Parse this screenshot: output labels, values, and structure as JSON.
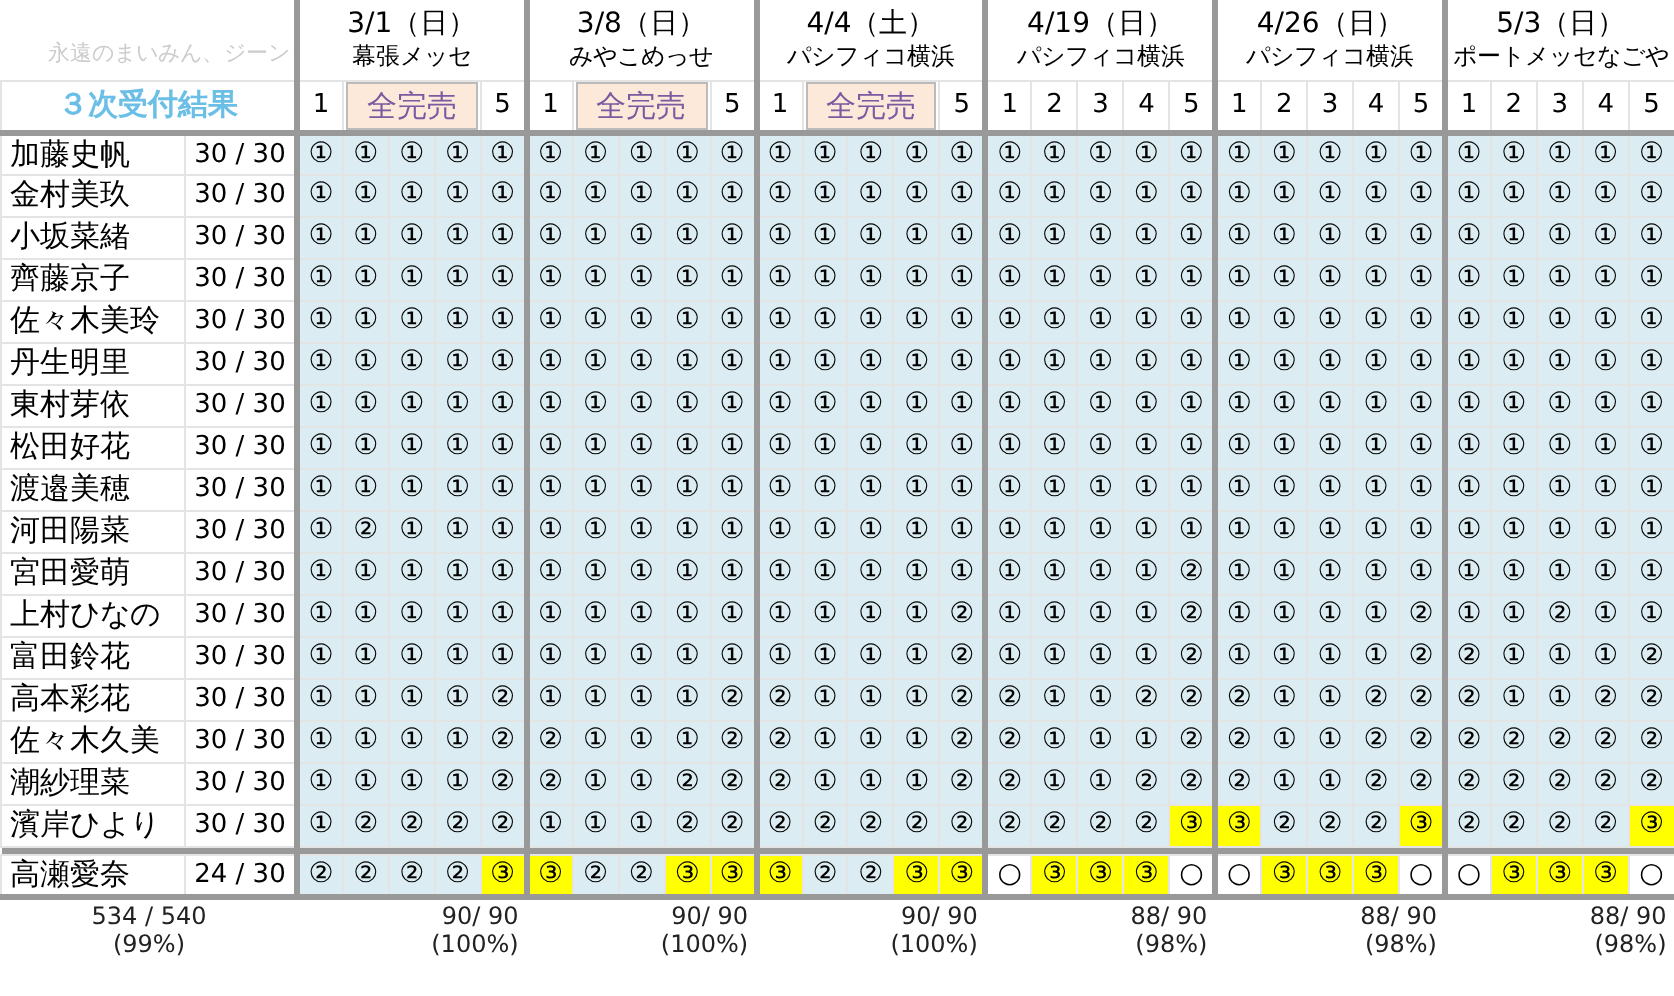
{
  "caption": "永遠のまいみん、ジーン",
  "title": "３次受付結果",
  "shows": [
    {
      "date": "3/1（日）",
      "venue": "幕張メッセ",
      "slot_labels": [
        "1",
        "5"
      ],
      "badge": "全完売",
      "total": "90/ 90",
      "percent": "(100%)"
    },
    {
      "date": "3/8（日）",
      "venue": "みやこめっせ",
      "slot_labels": [
        "1",
        "5"
      ],
      "badge": "全完売",
      "total": "90/ 90",
      "percent": "(100%)"
    },
    {
      "date": "4/4（土）",
      "venue": "パシフィコ横浜",
      "slot_labels": [
        "1",
        "5"
      ],
      "badge": "全完売",
      "total": "90/ 90",
      "percent": "(100%)"
    },
    {
      "date": "4/19（日）",
      "venue": "パシフィコ横浜",
      "slot_labels": [
        "1",
        "2",
        "3",
        "4",
        "5"
      ],
      "total": "88/ 90",
      "percent": "(98%)"
    },
    {
      "date": "4/26（日）",
      "venue": "パシフィコ横浜",
      "slot_labels": [
        "1",
        "2",
        "3",
        "4",
        "5"
      ],
      "total": "88/ 90",
      "percent": "(98%)"
    },
    {
      "date": "5/3（日）",
      "venue": "ポートメッセなごや",
      "slot_labels": [
        "1",
        "2",
        "3",
        "4",
        "5"
      ],
      "total": "88/ 90",
      "percent": "(98%)"
    }
  ],
  "members": [
    {
      "name": "加藤史帆",
      "count": "30 / 30",
      "cells": [
        "①",
        "①",
        "①",
        "①",
        "①",
        "①",
        "①",
        "①",
        "①",
        "①",
        "①",
        "①",
        "①",
        "①",
        "①",
        "①",
        "①",
        "①",
        "①",
        "①",
        "①",
        "①",
        "①",
        "①",
        "①",
        "①",
        "①",
        "①",
        "①",
        "①"
      ]
    },
    {
      "name": "金村美玖",
      "count": "30 / 30",
      "cells": [
        "①",
        "①",
        "①",
        "①",
        "①",
        "①",
        "①",
        "①",
        "①",
        "①",
        "①",
        "①",
        "①",
        "①",
        "①",
        "①",
        "①",
        "①",
        "①",
        "①",
        "①",
        "①",
        "①",
        "①",
        "①",
        "①",
        "①",
        "①",
        "①",
        "①"
      ]
    },
    {
      "name": "小坂菜緒",
      "count": "30 / 30",
      "cells": [
        "①",
        "①",
        "①",
        "①",
        "①",
        "①",
        "①",
        "①",
        "①",
        "①",
        "①",
        "①",
        "①",
        "①",
        "①",
        "①",
        "①",
        "①",
        "①",
        "①",
        "①",
        "①",
        "①",
        "①",
        "①",
        "①",
        "①",
        "①",
        "①",
        "①"
      ]
    },
    {
      "name": "齊藤京子",
      "count": "30 / 30",
      "cells": [
        "①",
        "①",
        "①",
        "①",
        "①",
        "①",
        "①",
        "①",
        "①",
        "①",
        "①",
        "①",
        "①",
        "①",
        "①",
        "①",
        "①",
        "①",
        "①",
        "①",
        "①",
        "①",
        "①",
        "①",
        "①",
        "①",
        "①",
        "①",
        "①",
        "①"
      ]
    },
    {
      "name": "佐々木美玲",
      "count": "30 / 30",
      "cells": [
        "①",
        "①",
        "①",
        "①",
        "①",
        "①",
        "①",
        "①",
        "①",
        "①",
        "①",
        "①",
        "①",
        "①",
        "①",
        "①",
        "①",
        "①",
        "①",
        "①",
        "①",
        "①",
        "①",
        "①",
        "①",
        "①",
        "①",
        "①",
        "①",
        "①"
      ]
    },
    {
      "name": "丹生明里",
      "count": "30 / 30",
      "cells": [
        "①",
        "①",
        "①",
        "①",
        "①",
        "①",
        "①",
        "①",
        "①",
        "①",
        "①",
        "①",
        "①",
        "①",
        "①",
        "①",
        "①",
        "①",
        "①",
        "①",
        "①",
        "①",
        "①",
        "①",
        "①",
        "①",
        "①",
        "①",
        "①",
        "①"
      ]
    },
    {
      "name": "東村芽依",
      "count": "30 / 30",
      "cells": [
        "①",
        "①",
        "①",
        "①",
        "①",
        "①",
        "①",
        "①",
        "①",
        "①",
        "①",
        "①",
        "①",
        "①",
        "①",
        "①",
        "①",
        "①",
        "①",
        "①",
        "①",
        "①",
        "①",
        "①",
        "①",
        "①",
        "①",
        "①",
        "①",
        "①"
      ]
    },
    {
      "name": "松田好花",
      "count": "30 / 30",
      "cells": [
        "①",
        "①",
        "①",
        "①",
        "①",
        "①",
        "①",
        "①",
        "①",
        "①",
        "①",
        "①",
        "①",
        "①",
        "①",
        "①",
        "①",
        "①",
        "①",
        "①",
        "①",
        "①",
        "①",
        "①",
        "①",
        "①",
        "①",
        "①",
        "①",
        "①"
      ]
    },
    {
      "name": "渡邉美穂",
      "count": "30 / 30",
      "cells": [
        "①",
        "①",
        "①",
        "①",
        "①",
        "①",
        "①",
        "①",
        "①",
        "①",
        "①",
        "①",
        "①",
        "①",
        "①",
        "①",
        "①",
        "①",
        "①",
        "①",
        "①",
        "①",
        "①",
        "①",
        "①",
        "①",
        "①",
        "①",
        "①",
        "①"
      ]
    },
    {
      "name": "河田陽菜",
      "count": "30 / 30",
      "cells": [
        "①",
        "②",
        "①",
        "①",
        "①",
        "①",
        "①",
        "①",
        "①",
        "①",
        "①",
        "①",
        "①",
        "①",
        "①",
        "①",
        "①",
        "①",
        "①",
        "①",
        "①",
        "①",
        "①",
        "①",
        "①",
        "①",
        "①",
        "①",
        "①",
        "①"
      ]
    },
    {
      "name": "宮田愛萌",
      "count": "30 / 30",
      "cells": [
        "①",
        "①",
        "①",
        "①",
        "①",
        "①",
        "①",
        "①",
        "①",
        "①",
        "①",
        "①",
        "①",
        "①",
        "①",
        "①",
        "①",
        "①",
        "①",
        "②",
        "①",
        "①",
        "①",
        "①",
        "①",
        "①",
        "①",
        "①",
        "①",
        "①"
      ]
    },
    {
      "name": "上村ひなの",
      "count": "30 / 30",
      "cells": [
        "①",
        "①",
        "①",
        "①",
        "①",
        "①",
        "①",
        "①",
        "①",
        "①",
        "①",
        "①",
        "①",
        "①",
        "②",
        "①",
        "①",
        "①",
        "①",
        "②",
        "①",
        "①",
        "①",
        "①",
        "②",
        "①",
        "①",
        "②",
        "①",
        "①"
      ]
    },
    {
      "name": "富田鈴花",
      "count": "30 / 30",
      "cells": [
        "①",
        "①",
        "①",
        "①",
        "①",
        "①",
        "①",
        "①",
        "①",
        "①",
        "①",
        "①",
        "①",
        "①",
        "②",
        "①",
        "①",
        "①",
        "①",
        "②",
        "①",
        "①",
        "①",
        "①",
        "②",
        "②",
        "①",
        "①",
        "①",
        "②"
      ]
    },
    {
      "name": "高本彩花",
      "count": "30 / 30",
      "cells": [
        "①",
        "①",
        "①",
        "①",
        "②",
        "①",
        "①",
        "①",
        "①",
        "②",
        "②",
        "①",
        "①",
        "①",
        "②",
        "②",
        "①",
        "①",
        "②",
        "②",
        "②",
        "①",
        "①",
        "②",
        "②",
        "②",
        "①",
        "①",
        "②",
        "②"
      ]
    },
    {
      "name": "佐々木久美",
      "count": "30 / 30",
      "cells": [
        "①",
        "①",
        "①",
        "①",
        "②",
        "②",
        "①",
        "①",
        "①",
        "②",
        "②",
        "①",
        "①",
        "①",
        "②",
        "②",
        "①",
        "①",
        "①",
        "②",
        "②",
        "①",
        "①",
        "②",
        "②",
        "②",
        "②",
        "②",
        "②",
        "②"
      ]
    },
    {
      "name": "潮紗理菜",
      "count": "30 / 30",
      "cells": [
        "①",
        "①",
        "①",
        "①",
        "②",
        "②",
        "①",
        "①",
        "②",
        "②",
        "②",
        "①",
        "①",
        "①",
        "②",
        "②",
        "①",
        "①",
        "②",
        "②",
        "②",
        "①",
        "①",
        "②",
        "②",
        "②",
        "②",
        "②",
        "②",
        "②"
      ]
    },
    {
      "name": "濱岸ひより",
      "count": "30 / 30",
      "cells": [
        "①",
        "②",
        "②",
        "②",
        "②",
        "①",
        "①",
        "①",
        "②",
        "②",
        "②",
        "②",
        "②",
        "②",
        "②",
        "②",
        "②",
        "②",
        "②",
        {
          "text": "③",
          "highlight": true
        },
        {
          "text": "③",
          "highlight": true
        },
        "②",
        "②",
        "②",
        {
          "text": "③",
          "highlight": true
        },
        "②",
        "②",
        "②",
        "②",
        {
          "text": "③",
          "highlight": true
        }
      ]
    },
    {
      "name": "高瀬愛奈",
      "count": "24 / 30",
      "divider_above": true,
      "cells": [
        "②",
        "②",
        "②",
        "②",
        {
          "text": "③",
          "highlight": true
        },
        {
          "text": "③",
          "highlight": true
        },
        "②",
        "②",
        {
          "text": "③",
          "highlight": true
        },
        {
          "text": "③",
          "highlight": true
        },
        {
          "text": "③",
          "highlight": true
        },
        "②",
        "②",
        {
          "text": "③",
          "highlight": true
        },
        {
          "text": "③",
          "highlight": true
        },
        {
          "text": "○",
          "vacant": true
        },
        {
          "text": "③",
          "highlight": true
        },
        {
          "text": "③",
          "highlight": true
        },
        {
          "text": "③",
          "highlight": true
        },
        {
          "text": "○",
          "vacant": true
        },
        {
          "text": "○",
          "vacant": true
        },
        {
          "text": "③",
          "highlight": true
        },
        {
          "text": "③",
          "highlight": true
        },
        {
          "text": "③",
          "highlight": true
        },
        {
          "text": "○",
          "vacant": true
        },
        {
          "text": "○",
          "vacant": true
        },
        {
          "text": "③",
          "highlight": true
        },
        {
          "text": "③",
          "highlight": true
        },
        {
          "text": "③",
          "highlight": true
        },
        {
          "text": "○",
          "vacant": true
        }
      ]
    }
  ],
  "grand_total": {
    "total": "534 / 540",
    "percent": "(99%)"
  }
}
